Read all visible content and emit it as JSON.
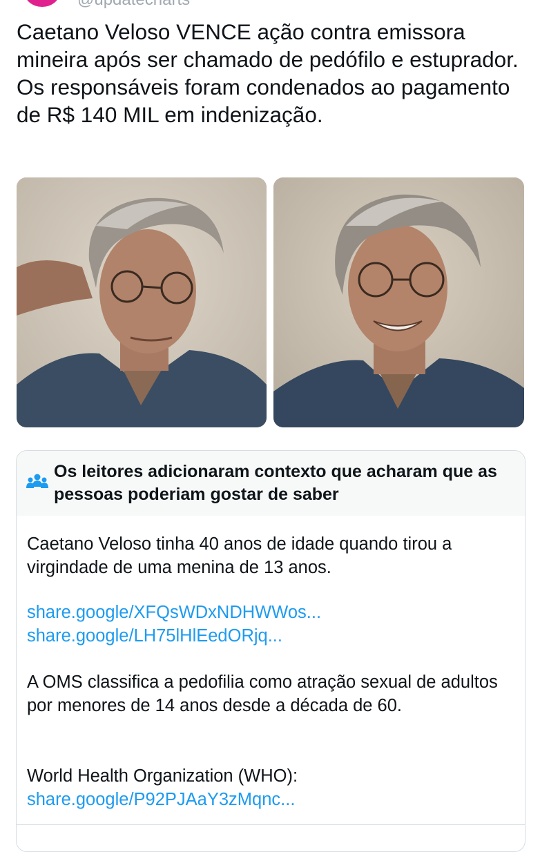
{
  "post": {
    "handle": "@updatecharts",
    "text": "Caetano Veloso VENCE ação contra emissora mineira após ser chamado de pedófilo e estuprador. Os responsáveis foram condenados ao pagamento de R$ 140 MIL em indenização."
  },
  "community_note": {
    "title": "Os leitores adicionaram contexto que acharam que as pessoas poderiam gostar de saber",
    "body_1": "Caetano Veloso tinha 40 anos de idade quando tirou a virgindade de uma menina de 13 anos.",
    "link_1": "share.google/XFQsWDxNDHWWos...",
    "link_2": "share.google/LH75lHlEedORjq...",
    "body_2": "A OMS classifica a pedofilia como atração sexual de adultos por menores de 14 anos desde a década de 60.",
    "source_label": "World Health Organization (WHO): ",
    "link_3": "share.google/P92PJAaY3zMqnc..."
  },
  "colors": {
    "link": "#1d9bf0",
    "text": "#0f1419",
    "avatar": "#e0208f",
    "note_header_bg": "#f7f9f9"
  }
}
